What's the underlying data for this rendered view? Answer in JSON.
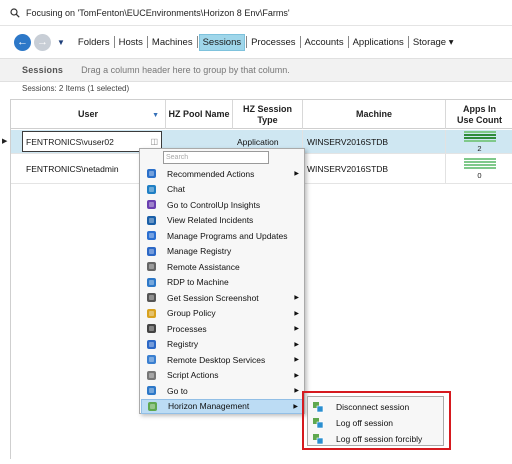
{
  "focus": {
    "text": "Focusing on 'TomFenton\\EUCEnvironments\\Horizon 8 Env\\Farms'"
  },
  "nav": {
    "items": [
      "Folders",
      "Hosts",
      "Machines",
      "Sessions",
      "Processes",
      "Accounts",
      "Applications",
      "Storage ▾"
    ],
    "active": "Sessions"
  },
  "groupbar": {
    "title": "Sessions",
    "hint": "Drag a column header here to group by that column."
  },
  "count_text": "Sessions: 2 Items (1 selected)",
  "columns": [
    "User",
    "HZ Pool Name",
    "HZ Session Type",
    "Machine",
    "Apps In Use Count"
  ],
  "rows": [
    {
      "user": "FENTRONICS\\vuser02",
      "pool": "",
      "type": "Application",
      "machine": "WINSERV2016STDB",
      "apps": "2"
    },
    {
      "user": "FENTRONICS\\netadmin",
      "pool": "",
      "type": "",
      "machine": "WINSERV2016STDB",
      "apps": "0"
    }
  ],
  "menu": {
    "search_placeholder": "Search",
    "items": [
      {
        "label": "Recommended Actions",
        "icon": "recommended-actions-icon",
        "submenu": true
      },
      {
        "label": "Chat",
        "icon": "chat-icon",
        "submenu": false
      },
      {
        "label": "Go to ControlUp Insights",
        "icon": "insights-icon",
        "submenu": false
      },
      {
        "label": "View Related Incidents",
        "icon": "incidents-icon",
        "submenu": false
      },
      {
        "label": "Manage Programs and Updates",
        "icon": "programs-icon",
        "submenu": false
      },
      {
        "label": "Manage Registry",
        "icon": "registry-icon",
        "submenu": false
      },
      {
        "label": "Remote Assistance",
        "icon": "remote-assistance-icon",
        "submenu": false
      },
      {
        "label": "RDP to Machine",
        "icon": "rdp-icon",
        "submenu": false
      },
      {
        "label": "Get Session Screenshot",
        "icon": "screenshot-icon",
        "submenu": true
      },
      {
        "label": "Group Policy",
        "icon": "group-policy-icon",
        "submenu": true
      },
      {
        "label": "Processes",
        "icon": "processes-icon",
        "submenu": true
      },
      {
        "label": "Registry",
        "icon": "registry-cube-icon",
        "submenu": true
      },
      {
        "label": "Remote Desktop Services",
        "icon": "rds-icon",
        "submenu": true
      },
      {
        "label": "Script Actions",
        "icon": "script-actions-icon",
        "submenu": true
      },
      {
        "label": "Go to",
        "icon": "goto-icon",
        "submenu": true
      },
      {
        "label": "Horizon Management",
        "icon": "horizon-icon",
        "submenu": true
      }
    ]
  },
  "submenu": {
    "items": [
      "Disconnect session",
      "Log off session",
      "Log off session forcibly"
    ]
  },
  "colors": {
    "accent": "#2d78c8",
    "selected_row": "#cfe7f2",
    "menu_highlight": "#bcdcf4",
    "red_frame": "#d61a1f"
  }
}
